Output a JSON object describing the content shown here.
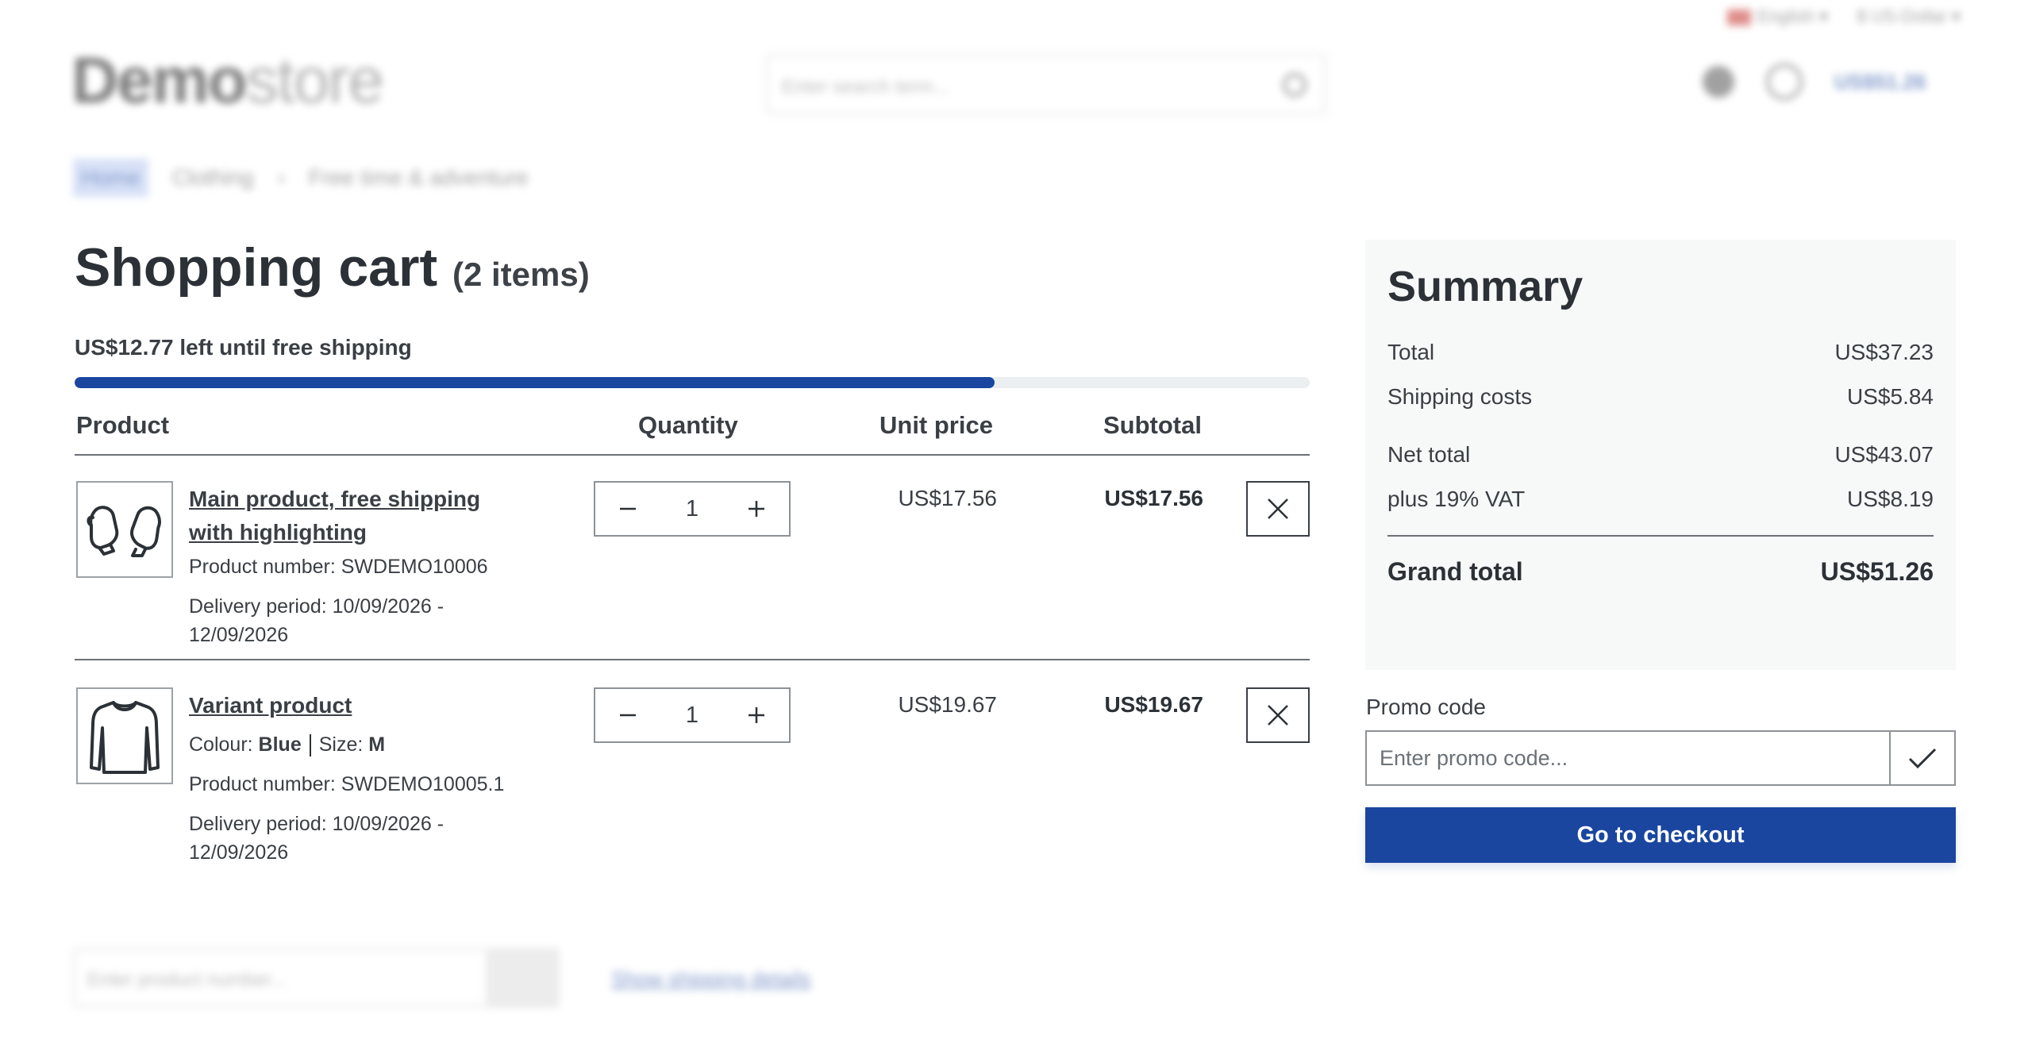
{
  "header": {
    "language": "English",
    "currency": "$ US-Dollar",
    "logo_bold": "Demo",
    "logo_light": "store",
    "search_placeholder": "Enter search term...",
    "cart_total": "US$51.26"
  },
  "breadcrumb": {
    "items": [
      "Home",
      "Clothing",
      "Free time & adventure"
    ]
  },
  "cart": {
    "title": "Shopping cart",
    "count": "(2 items)",
    "free_shipping_text": "US$12.77 left until free shipping",
    "free_shipping_progress_percent": 74.5,
    "columns": {
      "product": "Product",
      "quantity": "Quantity",
      "unit_price": "Unit price",
      "subtotal": "Subtotal"
    },
    "items": [
      {
        "icon": "mittens-icon",
        "name": "Main product, free shipping with highlighting",
        "product_number": "Product number: SWDEMO10006",
        "delivery": "Delivery period: 10/09/2026 - 12/09/2026",
        "quantity": "1",
        "unit_price": "US$17.56",
        "subtotal": "US$17.56"
      },
      {
        "icon": "sweater-icon",
        "name": "Variant product",
        "colour_label": "Colour:",
        "colour_value": "Blue",
        "size_label": "Size:",
        "size_value": "M",
        "product_number": "Product number: SWDEMO10005.1",
        "delivery": "Delivery period: 10/09/2026 - 12/09/2026",
        "quantity": "1",
        "unit_price": "US$19.67",
        "subtotal": "US$19.67"
      }
    ]
  },
  "summary": {
    "title": "Summary",
    "total_label": "Total",
    "total_value": "US$37.23",
    "shipping_label": "Shipping costs",
    "shipping_value": "US$5.84",
    "net_label": "Net total",
    "net_value": "US$43.07",
    "vat_label": "plus 19% VAT",
    "vat_value": "US$8.19",
    "grand_label": "Grand total",
    "grand_value": "US$51.26"
  },
  "promo": {
    "label": "Promo code",
    "placeholder": "Enter promo code..."
  },
  "checkout": {
    "label": "Go to checkout"
  },
  "footer_actions": {
    "add_product_placeholder": "Enter product number...",
    "view_link": "Show shipping details"
  },
  "colors": {
    "primary": "#1a46a0",
    "text": "#2b3136",
    "summary_bg": "#f7f8f8"
  }
}
